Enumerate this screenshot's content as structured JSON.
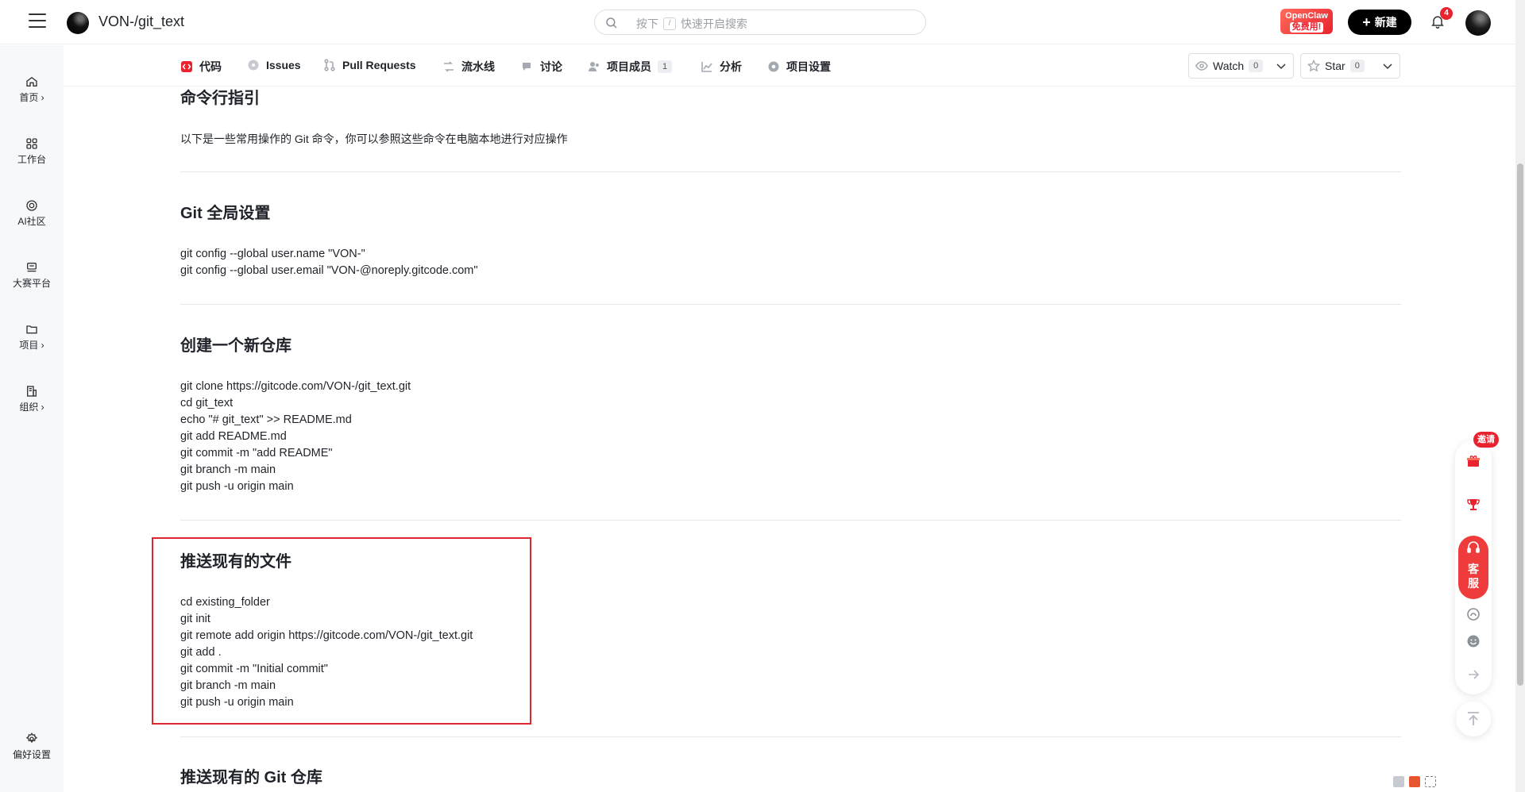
{
  "header": {
    "repo_title": "VON-/git_text",
    "search_placeholder": "快速开启搜索",
    "search_prefix": "按下",
    "search_key": "/",
    "promo_line1": "OpenClaw",
    "promo_line2": "免费用!",
    "new_label": "新建",
    "notification_count": "4"
  },
  "sidebar": {
    "items": [
      {
        "label": "首页 ›",
        "icon": "home-icon"
      },
      {
        "label": "工作台",
        "icon": "grid-icon"
      },
      {
        "label": "AI社区",
        "icon": "ai-icon"
      },
      {
        "label": "大赛平台",
        "icon": "trophy-board-icon"
      },
      {
        "label": "项目 ›",
        "icon": "folder-icon"
      },
      {
        "label": "组织 ›",
        "icon": "building-icon"
      }
    ],
    "settings_label": "偏好设置"
  },
  "tabs": [
    {
      "label": "代码",
      "icon": "code-icon"
    },
    {
      "label": "Issues",
      "icon": "issue-icon"
    },
    {
      "label": "Pull Requests",
      "icon": "pull-request-icon"
    },
    {
      "label": "流水线",
      "icon": "pipeline-icon"
    },
    {
      "label": "讨论",
      "icon": "discussion-icon"
    },
    {
      "label": "项目成员",
      "icon": "members-icon",
      "count": "1"
    },
    {
      "label": "分析",
      "icon": "chart-icon"
    },
    {
      "label": "项目设置",
      "icon": "settings-icon"
    }
  ],
  "actions": {
    "watch_label": "Watch",
    "watch_count": "0",
    "star_label": "Star",
    "star_count": "0"
  },
  "content": {
    "guide_title": "命令行指引",
    "guide_intro": "以下是一些常用操作的 Git 命令，你可以参照这些命令在电脑本地进行对应操作",
    "sections": [
      {
        "title": "Git 全局设置",
        "lines": [
          "git config --global user.name \"VON-\"",
          "git config --global user.email \"VON-@noreply.gitcode.com\""
        ]
      },
      {
        "title": "创建一个新仓库",
        "lines": [
          "git clone https://gitcode.com/VON-/git_text.git",
          "cd git_text",
          "echo \"# git_text\" >> README.md",
          "git add README.md",
          "git commit -m \"add README\"",
          "git branch -m main",
          "git push -u origin main"
        ]
      },
      {
        "title": "推送现有的文件",
        "lines": [
          "cd existing_folder",
          "git init",
          "git remote add origin https://gitcode.com/VON-/git_text.git",
          "git add .",
          "git commit -m \"Initial commit\"",
          "git branch -m main",
          "git push -u origin main"
        ]
      },
      {
        "title": "推送现有的 Git 仓库",
        "lines": []
      }
    ]
  },
  "float_toolbar": {
    "invite_label": "邀请",
    "service_label": "客服"
  },
  "colors": {
    "accent": "#e8232f",
    "highlight_box": "#e0262f",
    "text": "#1f2329"
  }
}
